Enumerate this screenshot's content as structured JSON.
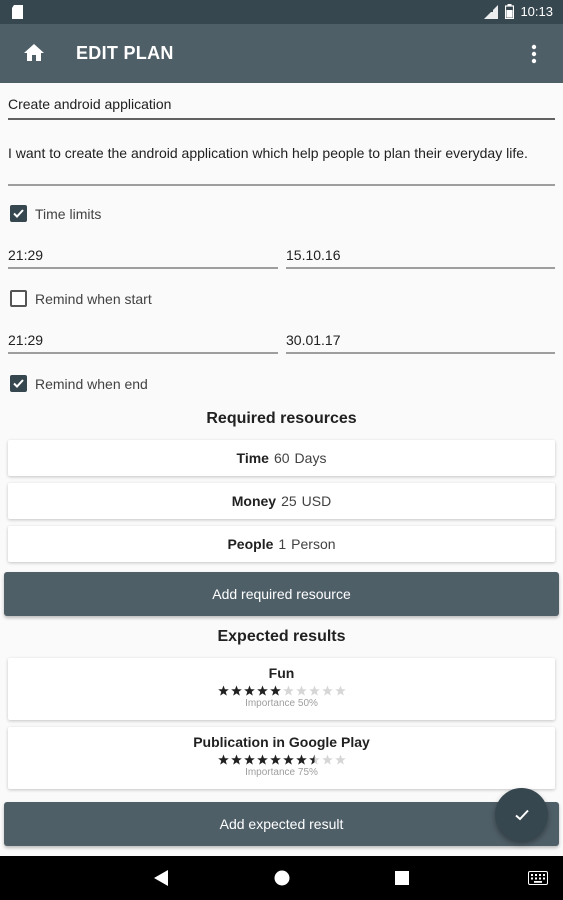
{
  "status_bar": {
    "time": "10:13"
  },
  "app_bar": {
    "title": "EDIT PLAN",
    "home_icon": "home-icon",
    "more_icon": "more-vert-icon"
  },
  "form": {
    "name_value": "Create android application",
    "description_value": "I want to create the android application which help people to plan their everyday life.",
    "time_limits": {
      "label": "Time limits",
      "checked": true
    },
    "start_time": "21:29",
    "start_date": "15.10.16",
    "remind_start": {
      "label": "Remind when start",
      "checked": false
    },
    "end_time": "21:29",
    "end_date": "30.01.17",
    "remind_end": {
      "label": "Remind when end",
      "checked": true
    }
  },
  "resources": {
    "title": "Required resources",
    "items": [
      {
        "name": "Time",
        "amount": "60",
        "unit": "Days"
      },
      {
        "name": "Money",
        "amount": "25",
        "unit": "USD"
      },
      {
        "name": "People",
        "amount": "1",
        "unit": "Person"
      }
    ],
    "add_label": "Add required resource"
  },
  "results": {
    "title": "Expected results",
    "items": [
      {
        "name": "Fun",
        "stars": 5,
        "max_stars": 10,
        "importance": "Importance 50%"
      },
      {
        "name": "Publication in  Google Play",
        "stars": 7.5,
        "max_stars": 10,
        "importance": "Importance 75%"
      }
    ],
    "add_label": "Add expected result"
  },
  "fab": {
    "icon": "check-icon"
  },
  "colors": {
    "primary": "#4f5f68",
    "status": "#37474f",
    "background": "#fafafa"
  }
}
